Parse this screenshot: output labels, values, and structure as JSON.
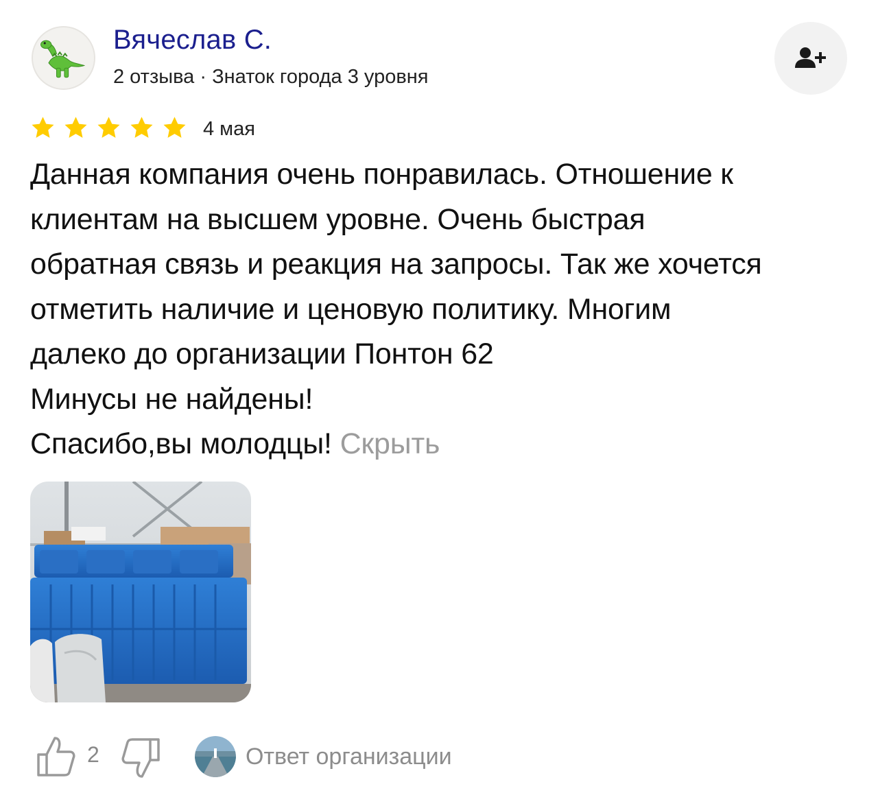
{
  "author": {
    "name": "Вячеслав С.",
    "meta": "2 отзыва · Знаток города 3 уровня",
    "avatar_icon": "dinosaur-icon"
  },
  "subscribe": {
    "icon": "add-user-icon"
  },
  "review": {
    "rating": 5,
    "rating_max": 5,
    "date": "4 мая",
    "text_lines": [
      "Данная компания очень понравилась. Отношение к",
      "клиентам на высшем уровне. Очень быстрая",
      "обратная связь и реакция на запросы. Так же хочется",
      "отметить наличие и ценовую политику. Многим",
      "далеко до организации Понтон 62",
      "Минусы не найдены!",
      "Спасибо,вы молодцы!"
    ],
    "hide_label": "Скрыть"
  },
  "footer": {
    "like_count": "2",
    "like_icon": "thumbs-up-icon",
    "dislike_icon": "thumbs-down-icon",
    "org_answer_label": "Ответ организации"
  },
  "colors": {
    "name": "#1b1f8e",
    "star": "#ffcc00",
    "muted": "#9c9c9c"
  }
}
